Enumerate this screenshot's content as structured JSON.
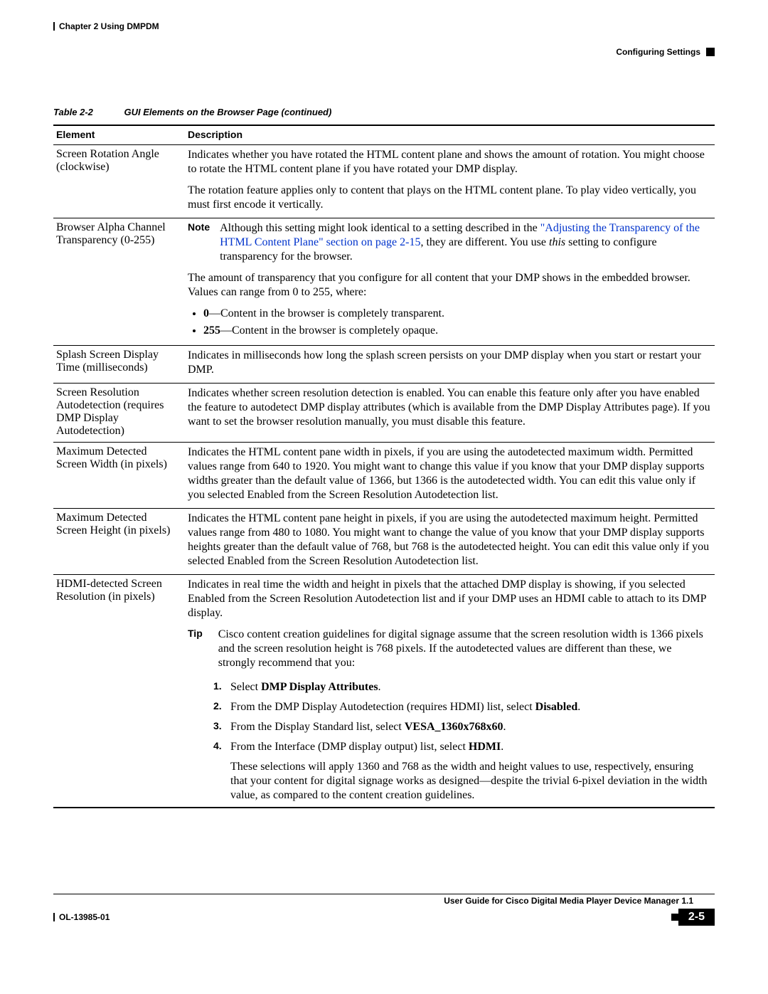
{
  "running_head": {
    "left": "Chapter 2    Using DMPDM",
    "right": "Configuring Settings"
  },
  "table_caption": {
    "number": "Table 2-2",
    "title": "GUI Elements on the Browser Page (continued)"
  },
  "headers": {
    "element": "Element",
    "description": "Description"
  },
  "rows": {
    "rotation": {
      "el": "Screen Rotation Angle (clockwise)",
      "p1": "Indicates whether you have rotated the HTML content plane and shows the amount of rotation. You might choose to rotate the HTML content plane if you have rotated your DMP display.",
      "p2": "The rotation feature applies only to content that plays on the HTML content plane. To play video vertically, you must first encode it vertically."
    },
    "alpha": {
      "el": "Browser Alpha Channel Transparency (0-255)",
      "note_label": "Note",
      "note_pre": "Although this setting might look identical to a setting described in the ",
      "note_link": "\"Adjusting the Transparency of the HTML Content Plane\" section on page 2-15",
      "note_post_a": ", they are different. You use ",
      "note_em": "this",
      "note_post_b": " setting to configure transparency for the browser.",
      "p2": "The amount of transparency that you configure for all content that your DMP shows in the embedded browser. Values can range from 0 to 255, where:",
      "li1_b": "0",
      "li1_t": "—Content in the browser is completely transparent.",
      "li2_b": "255",
      "li2_t": "—Content in the browser is completely opaque."
    },
    "splash": {
      "el": "Splash Screen Display Time (milliseconds)",
      "p": "Indicates in milliseconds how long the splash screen persists on your DMP display when you start or restart your DMP."
    },
    "autodet": {
      "el": "Screen Resolution Autodetection (requires DMP Display Autodetection)",
      "p": "Indicates whether screen resolution detection is enabled. You can enable this feature only after you have enabled the feature to autodetect DMP display attributes (which is available from the DMP Display Attributes page). If you want to set the browser resolution manually, you must disable this feature."
    },
    "maxw": {
      "el": "Maximum Detected Screen Width (in pixels)",
      "p": "Indicates the HTML content pane width in pixels, if you are using the autodetected maximum width. Permitted values range from 640 to 1920. You might want to change this value if you know that your DMP display supports widths greater than the default value of 1366, but 1366 is the autodetected width. You can edit this value only if you selected Enabled from the Screen Resolution Autodetection list."
    },
    "maxh": {
      "el": "Maximum Detected Screen Height (in pixels)",
      "p": "Indicates the HTML content pane height in pixels, if you are using the autodetected maximum height. Permitted values range from 480 to 1080. You might want to change the value of you know that your DMP display supports heights greater than the default value of 768, but 768 is the autodetected height. You can edit this value only if you selected Enabled from the Screen Resolution Autodetection list."
    },
    "hdmi": {
      "el": "HDMI-detected Screen Resolution (in pixels)",
      "p1": "Indicates in real time the width and height in pixels that the attached DMP display is showing, if you selected Enabled from the Screen Resolution Autodetection list and if your DMP uses an HDMI cable to attach to its DMP display.",
      "tip_label": "Tip",
      "tip": "Cisco content creation guidelines for digital signage assume that the screen resolution width is 1366 pixels and the screen resolution height is 768 pixels. If the autodetected values are different than these, we strongly recommend that you:",
      "s1_a": "Select ",
      "s1_b": "DMP Display Attributes",
      "s1_c": ".",
      "s2_a": "From the DMP Display Autodetection (requires HDMI) list, select ",
      "s2_b": "Disabled",
      "s2_c": ".",
      "s3_a": "From the Display Standard list, select ",
      "s3_b": "VESA_1360x768x60",
      "s3_c": ".",
      "s4_a": "From the Interface (DMP display output) list, select ",
      "s4_b": "HDMI",
      "s4_c": ".",
      "trail": "These selections will apply 1360 and 768 as the width and height values to use, respectively, ensuring that your content for digital signage works as designed—despite the trivial 6-pixel deviation in the width value, as compared to the content creation guidelines."
    }
  },
  "footer": {
    "book": "User Guide for Cisco Digital Media Player Device Manager 1.1",
    "doc": "OL-13985-01",
    "page": "2-5"
  }
}
